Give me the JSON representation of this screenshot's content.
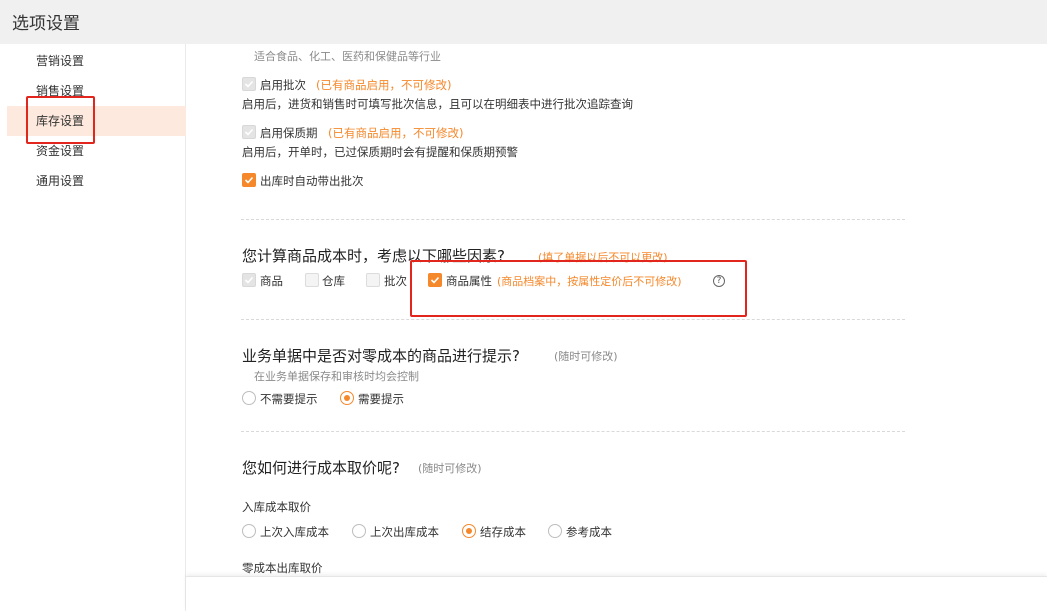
{
  "window": {
    "title": "选项设置"
  },
  "sidebar": {
    "items": [
      {
        "label": "营销设置"
      },
      {
        "label": "销售设置"
      },
      {
        "label": "库存设置",
        "active": true
      },
      {
        "label": "资金设置"
      },
      {
        "label": "通用设置"
      }
    ]
  },
  "inventory": {
    "industry_hint": "适合食品、化工、医药和保健品等行业",
    "batch": {
      "label": "启用批次",
      "note": "(已有商品启用，不可修改)",
      "desc": "启用后，进货和销售时可填写批次信息，且可以在明细表中进行批次追踪查询"
    },
    "shelf_life": {
      "label": "启用保质期",
      "note": "(已有商品启用，不可修改)",
      "desc": "启用后，开单时，已过保质期时会有提醒和保质期预警"
    },
    "auto_batch": {
      "label": "出库时自动带出批次"
    }
  },
  "cost_factors": {
    "question": "您计算商品成本时，考虑以下哪些因素?",
    "note": "(填了单据以后不可以更改)",
    "options": [
      {
        "label": "商品"
      },
      {
        "label": "仓库"
      },
      {
        "label": "批次"
      },
      {
        "label": "商品属性",
        "note": "(商品档案中，按属性定价后不可修改)"
      }
    ],
    "help_icon": "?"
  },
  "zero_cost": {
    "question": "业务单据中是否对零成本的商品进行提示?",
    "note": "(随时可修改)",
    "hint": "在业务单据保存和审核时均会控制",
    "options": [
      {
        "label": "不需要提示"
      },
      {
        "label": "需要提示"
      }
    ]
  },
  "cost_method": {
    "question": "您如何进行成本取价呢?",
    "note": "(随时可修改)",
    "inbound_title": "入库成本取价",
    "inbound_options": [
      {
        "label": "上次入库成本"
      },
      {
        "label": "上次出库成本"
      },
      {
        "label": "结存成本"
      },
      {
        "label": "参考成本"
      }
    ],
    "zero_outbound_title": "零成本出库取价"
  },
  "colors": {
    "accent": "#f5882b",
    "highlight": "#e3261d",
    "active_bg": "#fde9dd"
  }
}
